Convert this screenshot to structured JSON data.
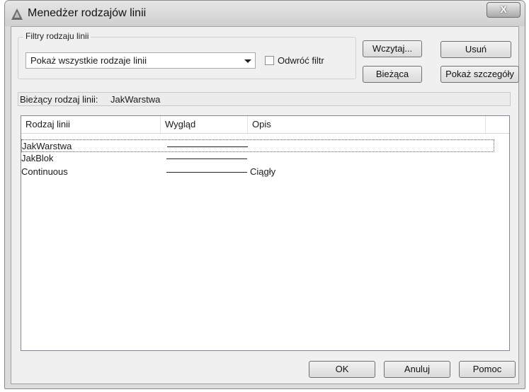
{
  "window": {
    "title": "Menedżer rodzajów linii",
    "app_icon": "autocad-icon",
    "close_glyph": "X"
  },
  "filters": {
    "group_label": "Filtry rodzaju linii",
    "dropdown_value": "Pokaż wszystkie rodzaje linii",
    "invert_label": "Odwróć filtr",
    "invert_checked": false
  },
  "buttons": {
    "load": "Wczytaj...",
    "delete": "Usuń",
    "current": "Bieżąca",
    "details": "Pokaż szczegóły",
    "ok": "OK",
    "cancel": "Anuluj",
    "help": "Pomoc"
  },
  "current_linetype": {
    "label": "Bieżący rodzaj linii:",
    "value": "JakWarstwa"
  },
  "list": {
    "columns": [
      "Rodzaj linii",
      "Wygląd",
      "Opis"
    ],
    "rows": [
      {
        "name": "JakWarstwa",
        "description": "",
        "selected": true
      },
      {
        "name": "JakBlok",
        "description": "",
        "selected": false
      },
      {
        "name": "Continuous",
        "description": "Ciągły",
        "selected": false
      }
    ]
  }
}
